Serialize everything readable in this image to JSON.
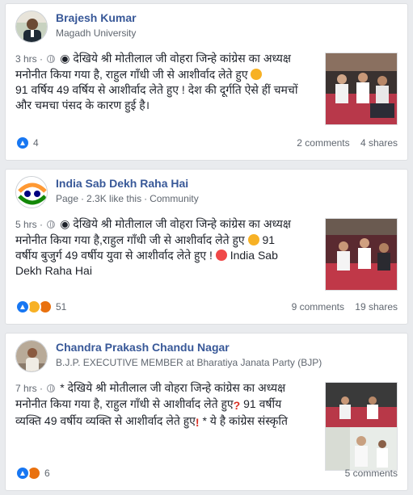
{
  "posts": [
    {
      "author": "Brajesh Kumar",
      "subtitle": "Magadh University",
      "time": "3 hrs",
      "text_line1": "◉ देखिये श्री मोतीलाल जी वोहरा जिन्हे कांग्रेस का अध्यक्ष",
      "text_line2": "मनोनीत किया गया है, राहुल गाँधी जी से आशीर्वाद लेते हुए",
      "text_line3": "91 वर्षिय 49 वर्षिय से आशीर्वाद लेते हुए ! देश की दूर्गति ऐसे हीं चमचों",
      "text_line4": "और चमचा पंसद के कारण हुई है।",
      "reaction_count": "4",
      "comments": "2 comments",
      "shares": "4 shares"
    },
    {
      "author": "India Sab Dekh Raha Hai",
      "page_label": "Page",
      "likes": "2.3K like this",
      "category": "Community",
      "time": "5 hrs",
      "text_line1": "◉ देखिये श्री मोतीलाल जी वोहरा जिन्हे कांग्रेस का अध्यक्ष",
      "text_line2": "मनोनीत किया गया है,राहुल गाँधी जी से आशीर्वाद लेते हुए",
      "text_line2b": "91",
      "text_line3": "वर्षीय बुजुर्ग 49 वर्षीय युवा से आशीर्वाद लेते हुए !",
      "text_line3b": "India Sab",
      "text_line4": "Dekh Raha Hai",
      "reaction_count": "51",
      "comments": "9 comments",
      "shares": "19 shares"
    },
    {
      "author": "Chandra Prakash Chandu Nagar",
      "subtitle": "B.J.P. EXECUTIVE MEMBER at Bharatiya Janata Party (BJP)",
      "time": "7 hrs",
      "text_line1": "* देखिये श्री मोतीलाल जी वोहरा जिन्हे कांग्रेस का अध्यक्ष",
      "text_line2": "मनोनीत किया गया है, राहुल गाँधी से आशीर्वाद लेते हुए",
      "text_line2b": "91 वर्षीय",
      "text_line3": "व्यक्ति 49 वर्षीय व्यक्ति से आशीर्वाद लेते हुए",
      "text_line3b": "* ये है कांग्रेस संस्कृति",
      "reaction_count": "6",
      "comments": "5 comments"
    }
  ],
  "colors": {
    "link": "#385898",
    "like": "#1877f2",
    "haha": "#f7b125",
    "angry": "#e9710f"
  }
}
